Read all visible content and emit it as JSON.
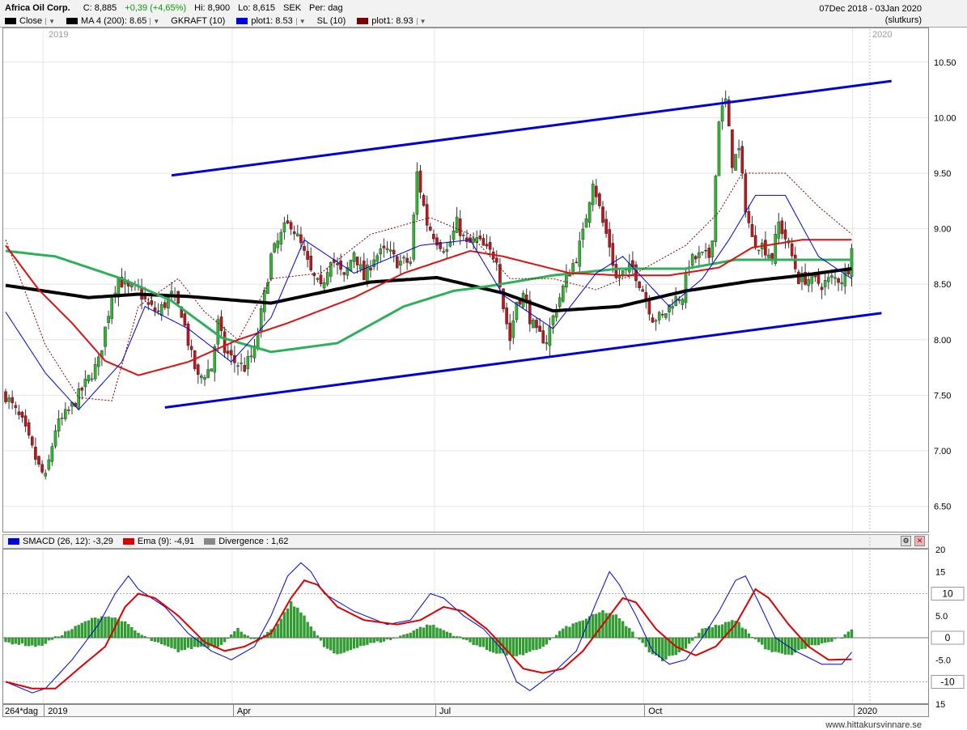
{
  "header": {
    "title": "Africa Oil Corp.",
    "close_label": "C: 8,885",
    "change": "+0,39 (+4,65%)",
    "hi": "Hi: 8,900",
    "lo": "Lo: 8,615",
    "currency": "SEK",
    "period": "Per: dag",
    "date_range": "07Dec 2018 - 03Jan 2020",
    "price_type": "(slutkurs)"
  },
  "legend": [
    {
      "label": "Close",
      "color": "#000000",
      "dropdown": true
    },
    {
      "label": "MA 4 (200): 8.65",
      "color": "#000000",
      "dropdown": true
    },
    {
      "label": "GKRAFT (10)",
      "color": null,
      "dropdown": false
    },
    {
      "label": "plot1: 8.53",
      "color": "#0000dd",
      "dropdown": true
    },
    {
      "label": "SL (10)",
      "color": null,
      "dropdown": false
    },
    {
      "label": "plot1: 8.93",
      "color": "#7a0000",
      "dropdown": true
    }
  ],
  "macd_legend": [
    {
      "label": "SMACD (26, 12): -3,29",
      "color": "#0000dd"
    },
    {
      "label": "Ema (9): -4,91",
      "color": "#dd0000"
    },
    {
      "label": "Divergence : 1,62",
      "color": "#888888"
    }
  ],
  "year_labels": {
    "left": "2019",
    "right": "2020"
  },
  "x_axis": {
    "period_label": "264*dag",
    "labels": [
      {
        "label": "2019",
        "idx": 12
      },
      {
        "label": "Apr",
        "idx": 69
      },
      {
        "label": "Jul",
        "idx": 130
      },
      {
        "label": "Oct",
        "idx": 193
      },
      {
        "label": "2020",
        "idx": 256
      }
    ]
  },
  "price_axis": {
    "ticks": [
      "10.50",
      "10.00",
      "9.50",
      "9.00",
      "8.50",
      "8.00",
      "7.50",
      "7.00",
      "6.50"
    ]
  },
  "macd_axis": {
    "ticks": [
      "20",
      "15",
      "5.0",
      "-5.0",
      "15"
    ],
    "boxed": [
      "10",
      "0",
      "-10"
    ]
  },
  "source": "www.hittakursvinnare.se",
  "chart_data": {
    "type": "candlestick",
    "x_start": "2018-12-07",
    "x_end": "2020-01-03",
    "ylim": [
      6.3,
      10.8
    ],
    "anchors": [
      [
        0,
        7.5
      ],
      [
        5,
        7.25
      ],
      [
        10,
        6.85
      ],
      [
        12,
        6.75
      ],
      [
        15,
        7.2
      ],
      [
        20,
        7.4
      ],
      [
        25,
        7.65
      ],
      [
        28,
        7.8
      ],
      [
        32,
        8.4
      ],
      [
        34,
        8.55
      ],
      [
        37,
        8.45
      ],
      [
        40,
        8.45
      ],
      [
        43,
        8.3
      ],
      [
        46,
        8.25
      ],
      [
        50,
        8.4
      ],
      [
        53,
        8.25
      ],
      [
        56,
        7.85
      ],
      [
        58,
        7.65
      ],
      [
        62,
        7.75
      ],
      [
        64,
        8.15
      ],
      [
        66,
        7.9
      ],
      [
        69,
        7.8
      ],
      [
        72,
        7.75
      ],
      [
        75,
        7.9
      ],
      [
        78,
        8.4
      ],
      [
        80,
        8.75
      ],
      [
        84,
        9.0
      ],
      [
        86,
        9.05
      ],
      [
        89,
        8.85
      ],
      [
        92,
        8.6
      ],
      [
        95,
        8.45
      ],
      [
        98,
        8.75
      ],
      [
        102,
        8.55
      ],
      [
        105,
        8.8
      ],
      [
        108,
        8.55
      ],
      [
        111,
        8.75
      ],
      [
        115,
        8.8
      ],
      [
        118,
        8.7
      ],
      [
        122,
        8.7
      ],
      [
        124,
        9.5
      ],
      [
        127,
        9.05
      ],
      [
        130,
        8.9
      ],
      [
        133,
        8.8
      ],
      [
        136,
        9.05
      ],
      [
        139,
        8.85
      ],
      [
        142,
        8.9
      ],
      [
        145,
        8.8
      ],
      [
        148,
        8.75
      ],
      [
        150,
        8.3
      ],
      [
        152,
        8.0
      ],
      [
        154,
        8.35
      ],
      [
        156,
        8.4
      ],
      [
        158,
        8.2
      ],
      [
        160,
        8.05
      ],
      [
        163,
        8.0
      ],
      [
        166,
        8.3
      ],
      [
        169,
        8.55
      ],
      [
        172,
        8.75
      ],
      [
        174,
        8.95
      ],
      [
        177,
        9.45
      ],
      [
        180,
        9.05
      ],
      [
        182,
        8.85
      ],
      [
        184,
        8.55
      ],
      [
        186,
        8.6
      ],
      [
        189,
        8.65
      ],
      [
        192,
        8.45
      ],
      [
        195,
        8.2
      ],
      [
        198,
        8.2
      ],
      [
        201,
        8.35
      ],
      [
        204,
        8.4
      ],
      [
        206,
        8.7
      ],
      [
        209,
        8.75
      ],
      [
        212,
        8.75
      ],
      [
        213,
        8.95
      ],
      [
        215,
        10.0
      ],
      [
        217,
        10.15
      ],
      [
        219,
        9.6
      ],
      [
        221,
        9.7
      ],
      [
        223,
        9.2
      ],
      [
        225,
        8.9
      ],
      [
        228,
        8.85
      ],
      [
        231,
        8.75
      ],
      [
        233,
        9.05
      ],
      [
        236,
        8.85
      ],
      [
        239,
        8.55
      ],
      [
        242,
        8.55
      ],
      [
        246,
        8.5
      ],
      [
        249,
        8.55
      ],
      [
        252,
        8.55
      ],
      [
        254,
        8.65
      ],
      [
        255,
        8.88
      ]
    ],
    "series": [
      {
        "name": "MA 4 (200)",
        "color": "#000000",
        "anchors": [
          [
            0,
            8.49
          ],
          [
            25,
            8.38
          ],
          [
            40,
            8.41
          ],
          [
            55,
            8.39
          ],
          [
            80,
            8.33
          ],
          [
            110,
            8.52
          ],
          [
            130,
            8.56
          ],
          [
            150,
            8.42
          ],
          [
            165,
            8.26
          ],
          [
            185,
            8.3
          ],
          [
            205,
            8.44
          ],
          [
            225,
            8.53
          ],
          [
            240,
            8.58
          ],
          [
            255,
            8.64
          ]
        ]
      },
      {
        "name": "MA (green)",
        "color": "#2eaf5a",
        "anchors": [
          [
            0,
            8.8
          ],
          [
            15,
            8.75
          ],
          [
            35,
            8.55
          ],
          [
            50,
            8.35
          ],
          [
            65,
            8.02
          ],
          [
            80,
            7.89
          ],
          [
            100,
            7.97
          ],
          [
            120,
            8.3
          ],
          [
            135,
            8.44
          ],
          [
            145,
            8.48
          ],
          [
            165,
            8.58
          ],
          [
            185,
            8.64
          ],
          [
            205,
            8.64
          ],
          [
            220,
            8.72
          ],
          [
            240,
            8.72
          ],
          [
            255,
            8.72
          ]
        ]
      },
      {
        "name": "MA (red)",
        "color": "#dd1111",
        "anchors": [
          [
            0,
            8.85
          ],
          [
            10,
            8.45
          ],
          [
            20,
            8.15
          ],
          [
            30,
            7.81
          ],
          [
            40,
            7.68
          ],
          [
            55,
            7.8
          ],
          [
            70,
            8.0
          ],
          [
            85,
            8.15
          ],
          [
            105,
            8.38
          ],
          [
            120,
            8.6
          ],
          [
            140,
            8.8
          ],
          [
            150,
            8.75
          ],
          [
            170,
            8.6
          ],
          [
            185,
            8.58
          ],
          [
            200,
            8.58
          ],
          [
            215,
            8.65
          ],
          [
            225,
            8.83
          ],
          [
            240,
            8.9
          ],
          [
            255,
            8.9
          ]
        ]
      },
      {
        "name": "plot1 (GKRAFT)",
        "color": "#0000dd",
        "anchors": [
          [
            0,
            8.25
          ],
          [
            12,
            7.7
          ],
          [
            22,
            7.37
          ],
          [
            35,
            7.8
          ],
          [
            42,
            8.3
          ],
          [
            55,
            8.1
          ],
          [
            68,
            7.8
          ],
          [
            80,
            8.2
          ],
          [
            90,
            8.9
          ],
          [
            105,
            8.6
          ],
          [
            125,
            8.85
          ],
          [
            140,
            8.9
          ],
          [
            150,
            8.4
          ],
          [
            165,
            8.1
          ],
          [
            178,
            8.6
          ],
          [
            186,
            8.75
          ],
          [
            200,
            8.3
          ],
          [
            210,
            8.55
          ],
          [
            218,
            8.9
          ],
          [
            226,
            9.3
          ],
          [
            235,
            9.3
          ],
          [
            245,
            8.75
          ],
          [
            255,
            8.55
          ]
        ]
      },
      {
        "name": "plot1 (SL)",
        "color": "#7a0000",
        "anchors": [
          [
            0,
            8.9
          ],
          [
            12,
            7.95
          ],
          [
            22,
            7.48
          ],
          [
            32,
            7.45
          ],
          [
            40,
            8.3
          ],
          [
            52,
            8.55
          ],
          [
            60,
            8.25
          ],
          [
            70,
            8.0
          ],
          [
            80,
            8.55
          ],
          [
            95,
            8.6
          ],
          [
            110,
            8.95
          ],
          [
            128,
            9.1
          ],
          [
            140,
            8.95
          ],
          [
            152,
            8.55
          ],
          [
            165,
            8.55
          ],
          [
            178,
            8.45
          ],
          [
            190,
            8.6
          ],
          [
            205,
            8.85
          ],
          [
            215,
            9.15
          ],
          [
            222,
            9.5
          ],
          [
            235,
            9.5
          ],
          [
            245,
            9.2
          ],
          [
            255,
            8.95
          ]
        ]
      }
    ],
    "trendlines": [
      {
        "name": "upper",
        "color": "#0000dd",
        "from": [
          50,
          9.48
        ],
        "to": [
          267,
          10.33
        ]
      },
      {
        "name": "lower",
        "color": "#0000dd",
        "from": [
          48,
          7.39
        ],
        "to": [
          264,
          8.24
        ]
      }
    ],
    "macd": {
      "ylim": [
        -15,
        20
      ],
      "smacd": [
        [
          0,
          -10
        ],
        [
          8,
          -12.5
        ],
        [
          12,
          -11.5
        ],
        [
          20,
          -5
        ],
        [
          28,
          3
        ],
        [
          33,
          10
        ],
        [
          37,
          14
        ],
        [
          40,
          11
        ],
        [
          48,
          7
        ],
        [
          55,
          1
        ],
        [
          62,
          -3
        ],
        [
          68,
          -5
        ],
        [
          75,
          -2
        ],
        [
          80,
          5
        ],
        [
          85,
          14
        ],
        [
          89,
          17
        ],
        [
          92,
          15
        ],
        [
          96,
          10
        ],
        [
          105,
          6
        ],
        [
          115,
          3
        ],
        [
          122,
          4
        ],
        [
          128,
          10
        ],
        [
          132,
          9
        ],
        [
          138,
          5
        ],
        [
          144,
          2
        ],
        [
          150,
          -3
        ],
        [
          154,
          -10
        ],
        [
          158,
          -12
        ],
        [
          165,
          -8
        ],
        [
          172,
          -3
        ],
        [
          178,
          8
        ],
        [
          182,
          15
        ],
        [
          185,
          12
        ],
        [
          190,
          5
        ],
        [
          195,
          -3
        ],
        [
          200,
          -6
        ],
        [
          205,
          -5
        ],
        [
          210,
          0
        ],
        [
          215,
          6
        ],
        [
          220,
          13
        ],
        [
          223,
          14
        ],
        [
          227,
          8
        ],
        [
          232,
          0
        ],
        [
          238,
          -3
        ],
        [
          246,
          -6
        ],
        [
          252,
          -6
        ],
        [
          255,
          -3.3
        ]
      ],
      "ema": [
        [
          0,
          -10
        ],
        [
          8,
          -11.5
        ],
        [
          15,
          -11.5
        ],
        [
          22,
          -7
        ],
        [
          30,
          -2
        ],
        [
          36,
          7
        ],
        [
          40,
          10
        ],
        [
          45,
          9
        ],
        [
          52,
          5
        ],
        [
          60,
          -1
        ],
        [
          66,
          -3
        ],
        [
          72,
          -2
        ],
        [
          80,
          1
        ],
        [
          86,
          9
        ],
        [
          90,
          13
        ],
        [
          94,
          12
        ],
        [
          100,
          7
        ],
        [
          108,
          4
        ],
        [
          118,
          3
        ],
        [
          125,
          4
        ],
        [
          132,
          7
        ],
        [
          138,
          6
        ],
        [
          145,
          2
        ],
        [
          150,
          -2
        ],
        [
          156,
          -7
        ],
        [
          162,
          -8
        ],
        [
          168,
          -7
        ],
        [
          174,
          -3
        ],
        [
          180,
          3
        ],
        [
          186,
          9
        ],
        [
          190,
          8
        ],
        [
          196,
          2
        ],
        [
          202,
          -2
        ],
        [
          208,
          -4
        ],
        [
          214,
          -2
        ],
        [
          220,
          3
        ],
        [
          226,
          11
        ],
        [
          230,
          9
        ],
        [
          236,
          3
        ],
        [
          242,
          -2
        ],
        [
          248,
          -5
        ],
        [
          255,
          -4.9
        ]
      ],
      "hist": [
        [
          0,
          -1
        ],
        [
          10,
          -2
        ],
        [
          20,
          2
        ],
        [
          25,
          4
        ],
        [
          30,
          5
        ],
        [
          35,
          4
        ],
        [
          40,
          1
        ],
        [
          45,
          -1
        ],
        [
          52,
          -3
        ],
        [
          58,
          -2
        ],
        [
          64,
          -2
        ],
        [
          70,
          2
        ],
        [
          76,
          -1
        ],
        [
          82,
          3
        ],
        [
          86,
          8
        ],
        [
          90,
          5
        ],
        [
          96,
          -2
        ],
        [
          100,
          -4
        ],
        [
          106,
          -2
        ],
        [
          112,
          -1
        ],
        [
          118,
          0
        ],
        [
          124,
          2
        ],
        [
          128,
          3
        ],
        [
          134,
          1
        ],
        [
          140,
          -1
        ],
        [
          146,
          -3
        ],
        [
          152,
          -4
        ],
        [
          156,
          -4
        ],
        [
          162,
          -2
        ],
        [
          168,
          2
        ],
        [
          174,
          4
        ],
        [
          180,
          6
        ],
        [
          184,
          5
        ],
        [
          188,
          2
        ],
        [
          194,
          -3
        ],
        [
          198,
          -5
        ],
        [
          204,
          -3
        ],
        [
          210,
          2
        ],
        [
          216,
          3
        ],
        [
          220,
          4
        ],
        [
          224,
          1
        ],
        [
          230,
          -3
        ],
        [
          236,
          -4
        ],
        [
          242,
          -2
        ],
        [
          248,
          -1
        ],
        [
          252,
          0
        ],
        [
          255,
          1.62
        ]
      ]
    }
  }
}
